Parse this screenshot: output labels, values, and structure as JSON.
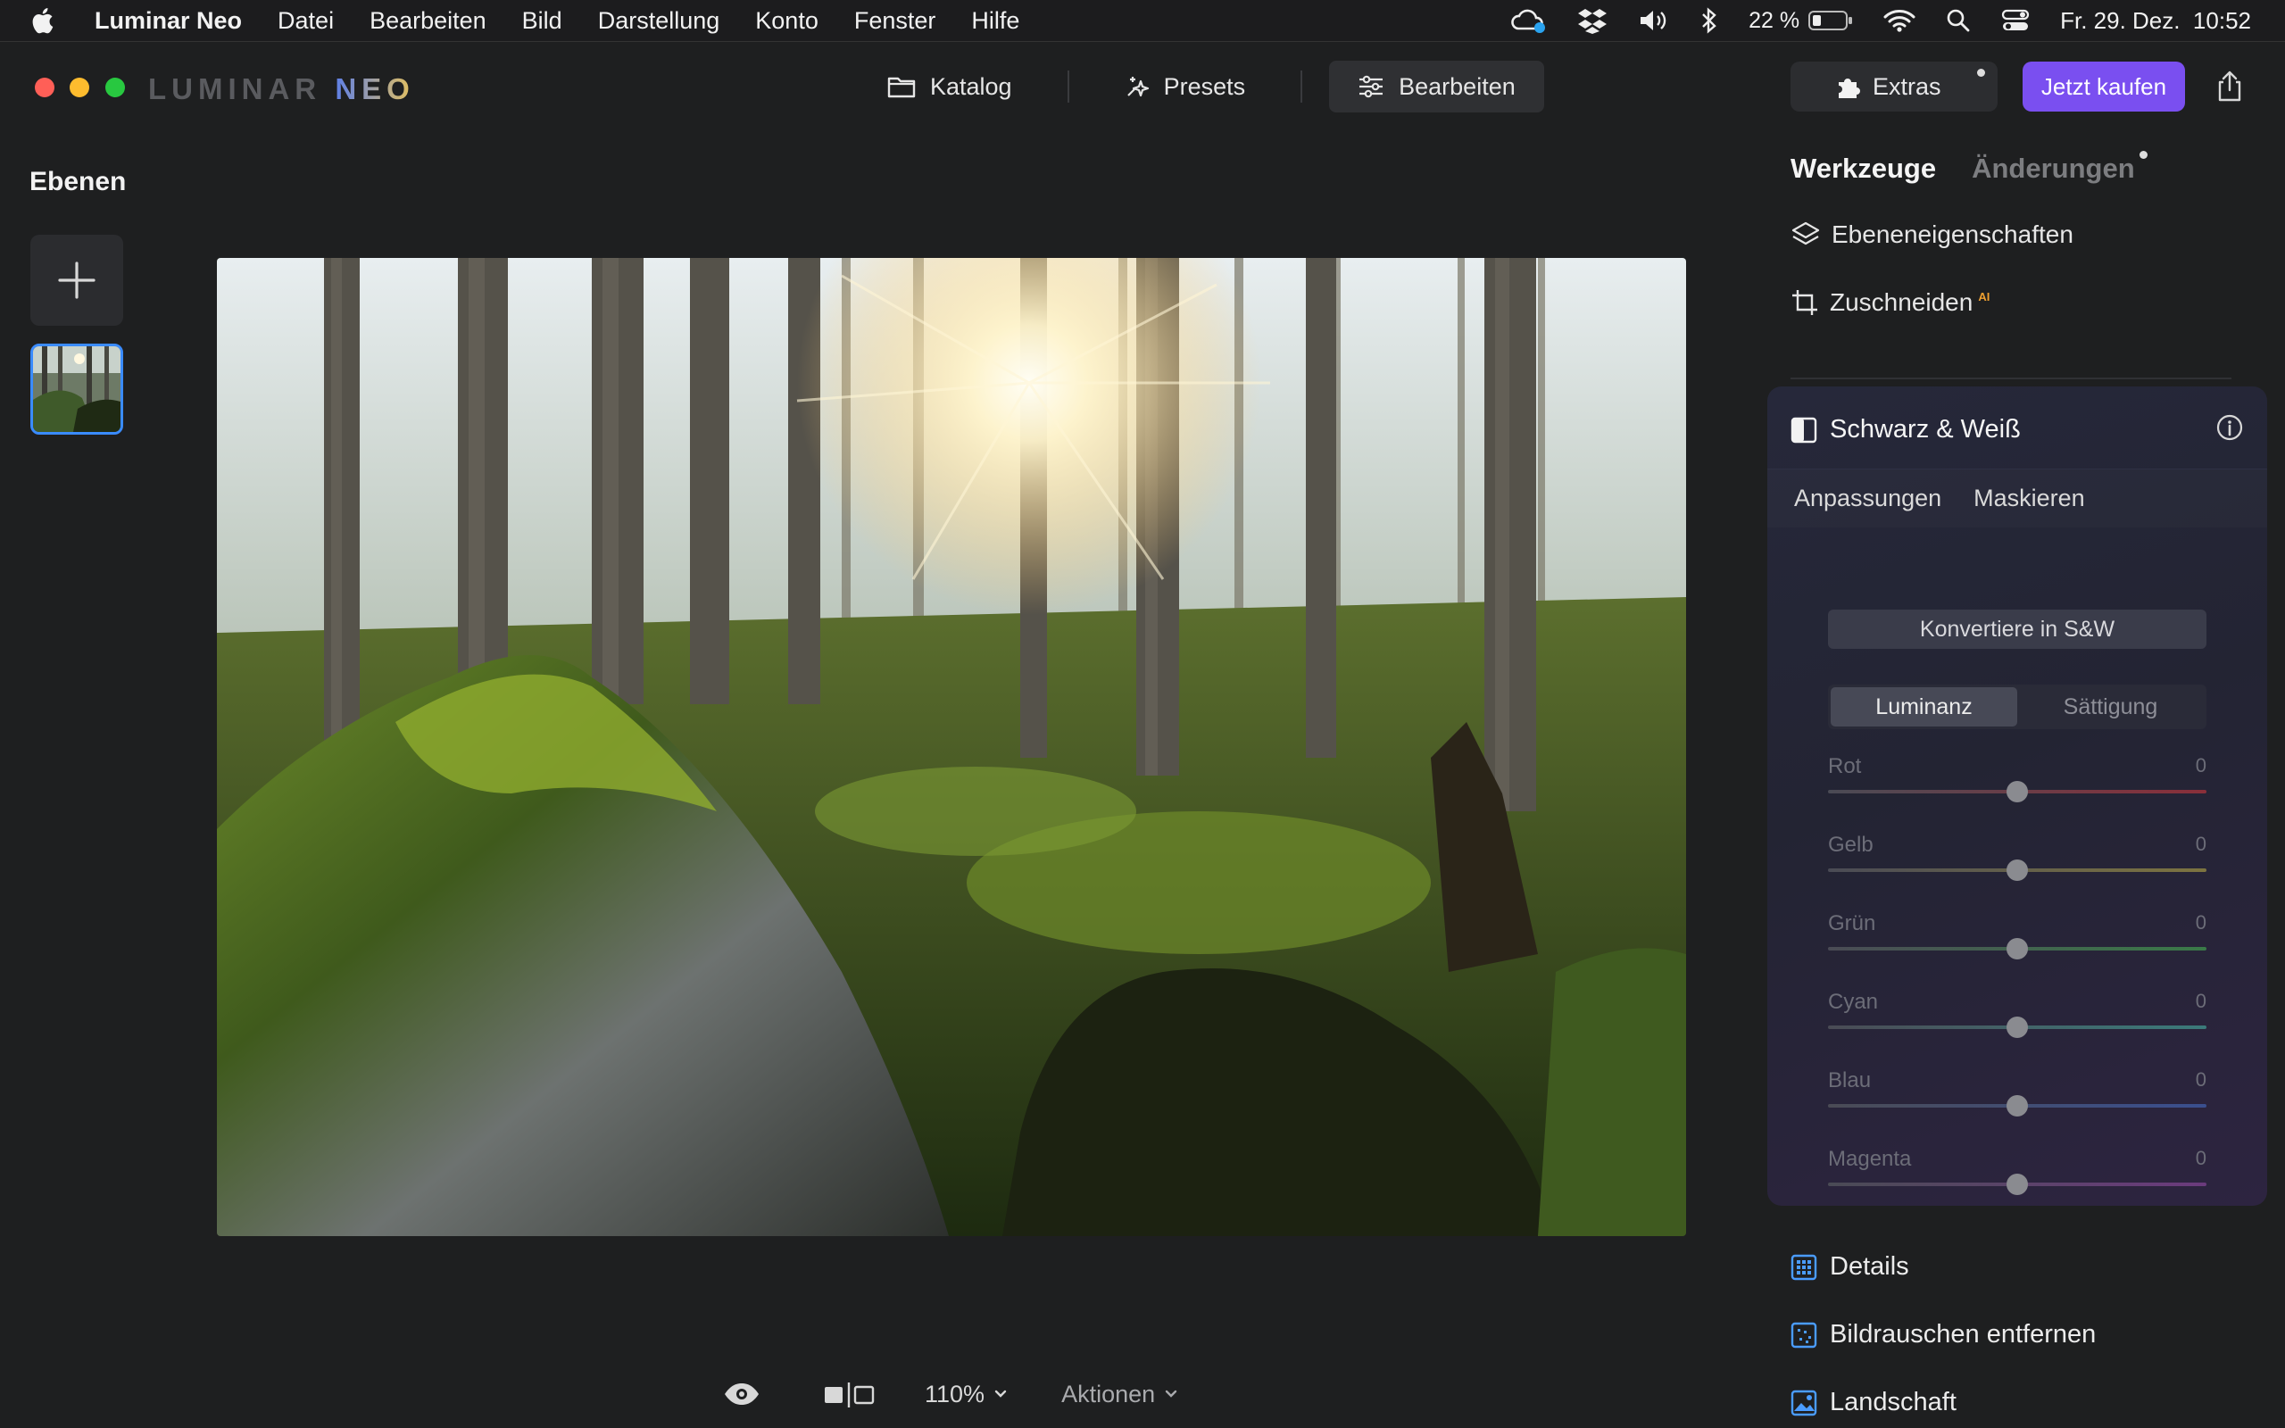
{
  "menubar": {
    "app_name": "Luminar Neo",
    "menus": [
      "Datei",
      "Bearbeiten",
      "Bild",
      "Darstellung",
      "Konto",
      "Fenster",
      "Hilfe"
    ],
    "battery": "22 %",
    "datetime": "Fr. 29. Dez.  10:52"
  },
  "window": {
    "logo_left": "LUMINAR",
    "logo_right": "NEO",
    "modes": [
      {
        "label": "Katalog",
        "icon": "folder-icon"
      },
      {
        "label": "Presets",
        "icon": "sparkle-icon"
      },
      {
        "label": "Bearbeiten",
        "icon": "sliders-icon",
        "active": true
      }
    ],
    "extras_label": "Extras",
    "buy_label": "Jetzt kaufen"
  },
  "layers": {
    "title": "Ebenen"
  },
  "bottom_bar": {
    "zoom": "110%",
    "actions": "Aktionen"
  },
  "right_panel": {
    "tab_tools": "Werkzeuge",
    "tab_changes": "Änderungen",
    "layer_props": "Ebeneneigenschaften",
    "crop": "Zuschneiden",
    "crop_badge": "AI",
    "bw": {
      "title": "Schwarz & Weiß",
      "subtab_adjust": "Anpassungen",
      "subtab_mask": "Maskieren",
      "convert": "Konvertiere in S&W",
      "seg_luminance": "Luminanz",
      "seg_saturation": "Sättigung",
      "sliders": [
        {
          "name": "Rot",
          "value": "0",
          "color": "#8a2f3a"
        },
        {
          "name": "Gelb",
          "value": "0",
          "color": "#7d7440"
        },
        {
          "name": "Grün",
          "value": "0",
          "color": "#3a7a48"
        },
        {
          "name": "Cyan",
          "value": "0",
          "color": "#3b7a7a"
        },
        {
          "name": "Blau",
          "value": "0",
          "color": "#3a4f8f"
        },
        {
          "name": "Magenta",
          "value": "0",
          "color": "#6b3b7d"
        }
      ]
    },
    "sections": [
      {
        "label": "Details",
        "icon": "details-icon"
      },
      {
        "label": "Bildrauschen entfernen",
        "icon": "denoise-icon"
      },
      {
        "label": "Landschaft",
        "icon": "landscape-icon"
      }
    ]
  }
}
